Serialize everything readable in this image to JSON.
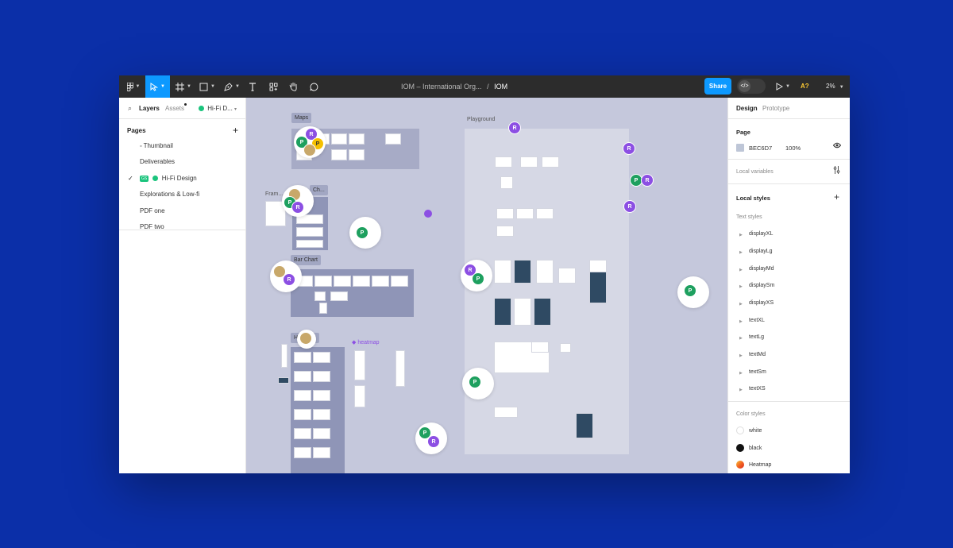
{
  "toolbar": {
    "title_prefix": "IOM – International Org...",
    "separator": "/",
    "title_current": "IOM",
    "share_label": "Share",
    "a_label": "A?",
    "zoom_label": "2%"
  },
  "left_panel": {
    "tabs": {
      "layers": "Layers",
      "assets": "Assets",
      "page_selector": "Hi-Fi D..."
    },
    "pages_header": "Pages",
    "pages": [
      {
        "label": "Thumbnail",
        "active": false
      },
      {
        "label": "Deliverables",
        "active": false
      },
      {
        "label": "Hi-Fi Design",
        "active": true,
        "badge": "GS"
      },
      {
        "label": "Explorations & Low-fi",
        "active": false
      },
      {
        "label": "PDF one",
        "active": false
      },
      {
        "label": "PDF two",
        "active": false
      }
    ],
    "check_mark": "✓"
  },
  "canvas": {
    "frames": {
      "maps": "Maps",
      "playground": "Playground",
      "frame_partial": "Fram...",
      "ch_partial": "Ch...",
      "bar_chart": "Bar Chart",
      "heatmaps_partial": "H...maps",
      "heatmap_component": "◆ heatmap"
    },
    "avatar_p": "P",
    "avatar_r": "R"
  },
  "right_panel": {
    "tabs": {
      "design": "Design",
      "prototype": "Prototype"
    },
    "page_section": "Page",
    "page_color_hex": "BEC6D7",
    "page_color_opacity": "100%",
    "page_color": "#bec6d7",
    "local_variables": "Local variables",
    "local_styles": "Local styles",
    "text_styles_header": "Text styles",
    "text_styles": [
      "displayXL",
      "displayLg",
      "displayMd",
      "displaySm",
      "displayXS",
      "textXL",
      "textLg",
      "textMd",
      "textSm",
      "textXS"
    ],
    "color_styles_header": "Color styles",
    "color_styles": [
      {
        "name": "white",
        "color": "#ffffff"
      },
      {
        "name": "black",
        "color": "#111111"
      },
      {
        "name": "Heatmap",
        "color": "#f26522"
      }
    ]
  },
  "colors": {
    "background": "#0b2fa8",
    "toolbar": "#2c2c2c",
    "accent": "#0d99ff",
    "canvas": "#c5c8dc",
    "avatar_p": "#1ea05f",
    "avatar_r": "#8c4fe3"
  }
}
